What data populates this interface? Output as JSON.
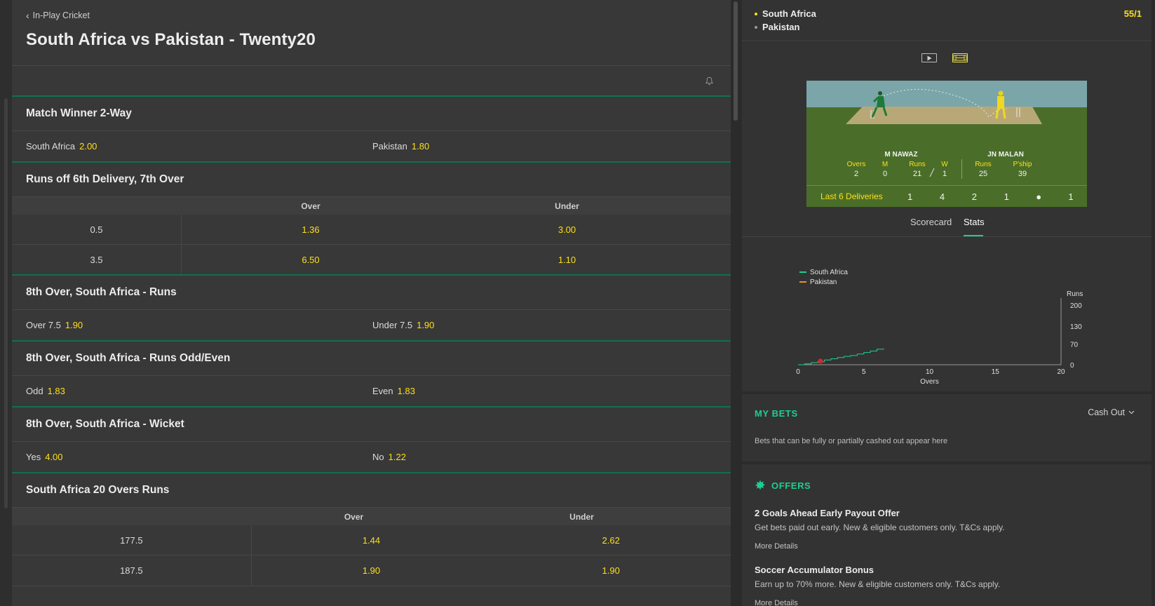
{
  "header": {
    "back_label": "In-Play Cricket",
    "title": "South Africa vs Pakistan - Twenty20"
  },
  "markets": {
    "match_winner": {
      "title": "Match Winner 2-Way",
      "home_label": "South Africa",
      "home_odds": "2.00",
      "away_label": "Pakistan",
      "away_odds": "1.80"
    },
    "delivery_runs": {
      "title": "Runs off 6th Delivery, 7th Over",
      "col_over": "Over",
      "col_under": "Under",
      "rows": [
        {
          "line": "0.5",
          "over": "1.36",
          "under": "3.00"
        },
        {
          "line": "3.5",
          "over": "6.50",
          "under": "1.10"
        }
      ]
    },
    "over_runs": {
      "title": "8th Over, South Africa - Runs",
      "a_label": "Over 7.5",
      "a_odds": "1.90",
      "b_label": "Under 7.5",
      "b_odds": "1.90"
    },
    "odd_even": {
      "title": "8th Over, South Africa - Runs Odd/Even",
      "a_label": "Odd",
      "a_odds": "1.83",
      "b_label": "Even",
      "b_odds": "1.83"
    },
    "wicket": {
      "title": "8th Over, South Africa - Wicket",
      "a_label": "Yes",
      "a_odds": "4.00",
      "b_label": "No",
      "b_odds": "1.22"
    },
    "total_runs": {
      "title": "South Africa 20 Overs Runs",
      "col_over": "Over",
      "col_under": "Under",
      "rows": [
        {
          "line": "177.5",
          "over": "1.44",
          "under": "2.62"
        },
        {
          "line": "187.5",
          "over": "1.90",
          "under": "1.90"
        }
      ]
    }
  },
  "scoreboard": {
    "team1": "South Africa",
    "team2": "Pakistan",
    "score": "55/1",
    "team1_color": "#ffdf1b",
    "team2_color": "#9a9a9a"
  },
  "visualisation": {
    "bowler": {
      "name": "M NAWAZ",
      "stats": [
        {
          "label": "Overs",
          "value": "2"
        },
        {
          "label": "M",
          "value": "0"
        },
        {
          "label": "Runs",
          "value": "21"
        },
        {
          "label": "W",
          "value": "1"
        }
      ]
    },
    "batsman": {
      "name": "JN MALAN",
      "stats": [
        {
          "label": "Runs",
          "value": "25"
        },
        {
          "label": "P'ship",
          "value": "39"
        }
      ]
    },
    "last6_label": "Last 6 Deliveries",
    "last6": [
      "1",
      "4",
      "2",
      "1",
      "●",
      "1"
    ],
    "tabs": [
      "Scorecard",
      "Stats"
    ],
    "active_tab": "Stats"
  },
  "chart_data": {
    "type": "line",
    "xlabel": "Overs",
    "ylabel": "Runs",
    "xlim": [
      0,
      20
    ],
    "ylim": [
      0,
      200
    ],
    "xticks": [
      "0",
      "5",
      "10",
      "15",
      "20"
    ],
    "yticks": [
      "0",
      "70",
      "130",
      "200"
    ],
    "legend_position": "top-left",
    "series": [
      {
        "name": "South Africa",
        "color": "#1dcf8e",
        "x": [
          0,
          0.5,
          1,
          1.5,
          2,
          2.5,
          3,
          3.5,
          4,
          4.5,
          5,
          5.5,
          6,
          6.5
        ],
        "values": [
          0,
          3,
          7,
          10,
          16,
          20,
          24,
          28,
          31,
          36,
          41,
          46,
          52,
          55
        ]
      },
      {
        "name": "Pakistan",
        "color": "#e8912d",
        "x": [],
        "values": []
      }
    ],
    "wickets": [
      {
        "x": 1.7,
        "y": 12
      }
    ]
  },
  "my_bets": {
    "title": "MY BETS",
    "cash_out_label": "Cash Out",
    "info": "Bets that can be fully or partially cashed out appear here"
  },
  "offers": {
    "title": "OFFERS",
    "items": [
      {
        "title": "2 Goals Ahead Early Payout Offer",
        "desc": "Get bets paid out early. New & eligible customers only. T&Cs apply.",
        "link": "More Details"
      },
      {
        "title": "Soccer Accumulator Bonus",
        "desc": "Earn up to 70% more. New & eligible customers only. T&Cs apply.",
        "link": "More Details"
      }
    ]
  }
}
